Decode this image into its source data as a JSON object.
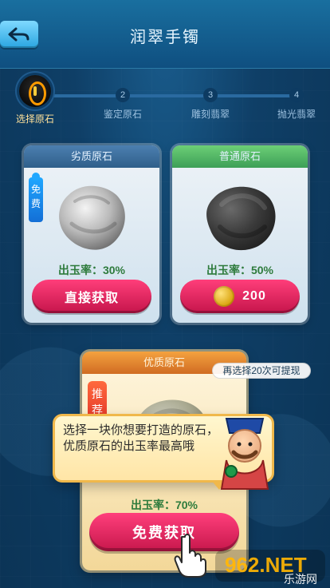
{
  "header": {
    "title": "润翠手镯"
  },
  "steps": [
    {
      "num": "",
      "label": "选择原石"
    },
    {
      "num": "2",
      "label": "鉴定原石"
    },
    {
      "num": "3",
      "label": "雕刻翡翠"
    },
    {
      "num": "4",
      "label": "抛光翡翠"
    }
  ],
  "cards": {
    "inferior": {
      "title": "劣质原石",
      "tag": "免费",
      "rate": "出玉率：30%",
      "action_label": "直接获取"
    },
    "normal": {
      "title": "普通原石",
      "rate": "出玉率：50%",
      "price": "200"
    },
    "premium": {
      "title": "优质原石",
      "limit_text": "再选择20次可提现",
      "tag": "推荐",
      "rate": "出玉率：70%",
      "action_label": "免费获取"
    }
  },
  "tooltip": {
    "text": "选择一块你想要打造的原石，优质原石的出玉率最高哦"
  },
  "watermark": {
    "text": "962.NET",
    "sub": "乐游网"
  },
  "colors": {
    "accent_pink": "#ff3f7c",
    "accent_gold": "#f0b84b",
    "rate_green": "#2e7b3c"
  }
}
